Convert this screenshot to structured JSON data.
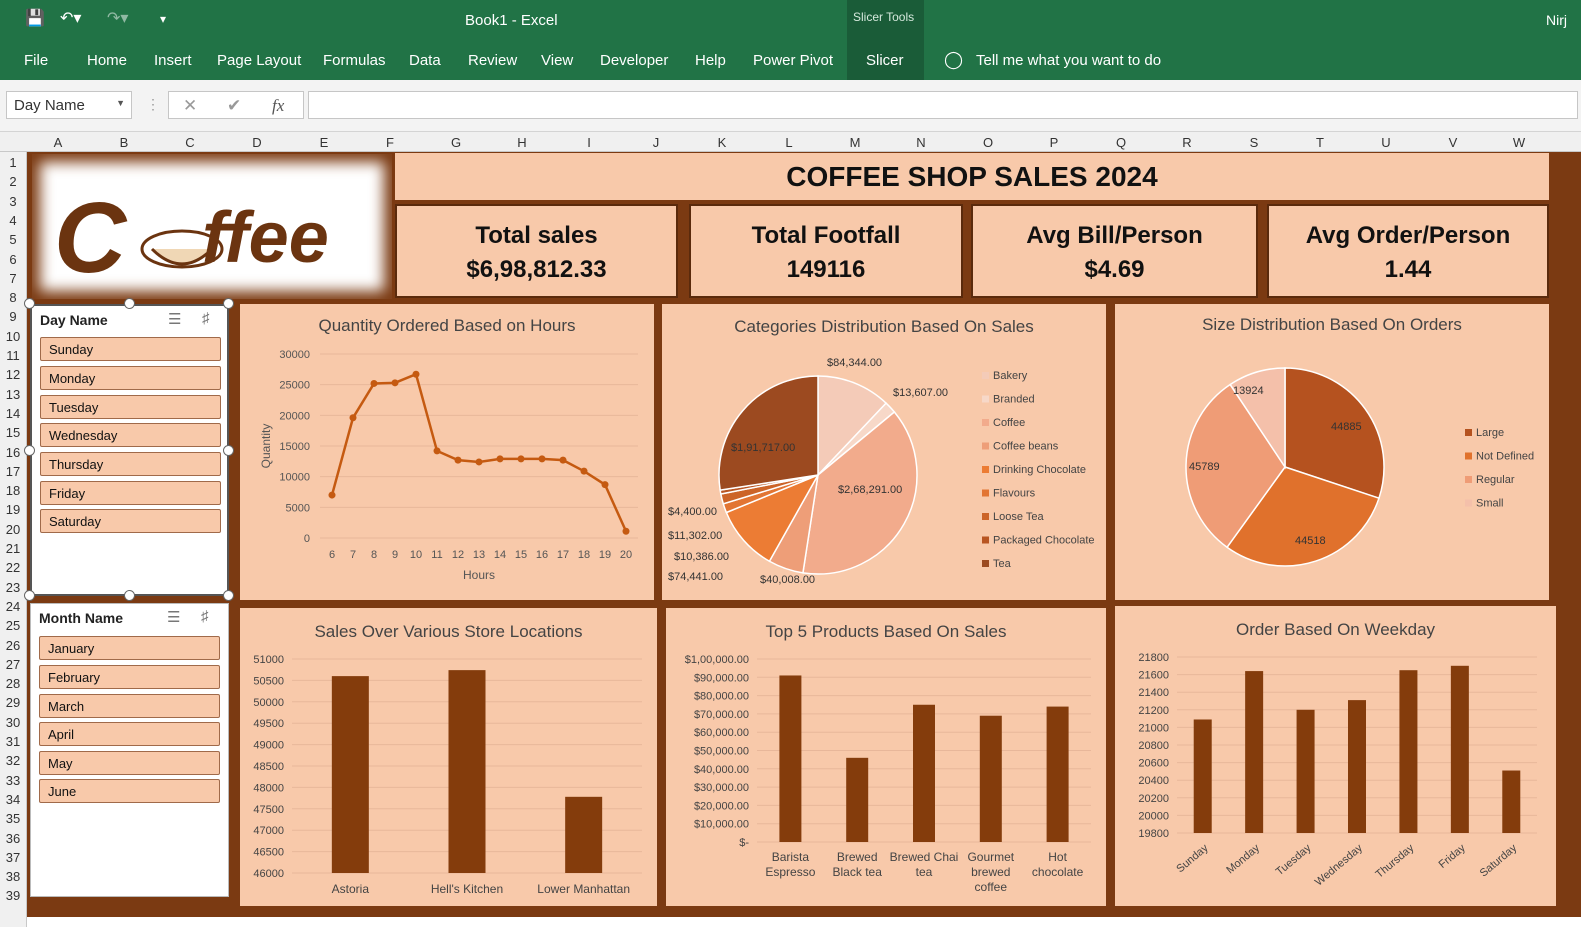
{
  "app": {
    "title": "Book1  -  Excel",
    "user": "Nirj",
    "contextual_tab": "Slicer Tools"
  },
  "menu": [
    "File",
    "Home",
    "Insert",
    "Page Layout",
    "Formulas",
    "Data",
    "Review",
    "View",
    "Developer",
    "Help",
    "Power Pivot",
    "Slicer"
  ],
  "tell_me": "Tell me what you want to do",
  "name_box": "Day Name",
  "columns": [
    "A",
    "B",
    "C",
    "D",
    "E",
    "F",
    "G",
    "H",
    "I",
    "J",
    "K",
    "L",
    "M",
    "N",
    "O",
    "P",
    "Q",
    "R",
    "S",
    "T",
    "U",
    "V",
    "W"
  ],
  "rows": [
    "1",
    "2",
    "3",
    "4",
    "5",
    "6",
    "7",
    "8",
    "9",
    "10",
    "11",
    "12",
    "13",
    "14",
    "15",
    "16",
    "17",
    "18",
    "19",
    "20",
    "21",
    "22",
    "23",
    "24",
    "25",
    "26",
    "27",
    "28",
    "29",
    "30",
    "31",
    "32",
    "33",
    "34",
    "35",
    "36",
    "37",
    "38",
    "39"
  ],
  "dashboard": {
    "title": "COFFEE SHOP SALES 2024",
    "kpis": [
      {
        "label": "Total sales",
        "value": "$6,98,812.33"
      },
      {
        "label": "Total Footfall",
        "value": "149116"
      },
      {
        "label": "Avg Bill/Person",
        "value": "$4.69"
      },
      {
        "label": "Avg Order/Person",
        "value": "1.44"
      }
    ],
    "logo_text": "Coffee"
  },
  "slicers": {
    "day": {
      "header": "Day Name",
      "items": [
        "Sunday",
        "Monday",
        "Tuesday",
        "Wednesday",
        "Thursday",
        "Friday",
        "Saturday"
      ]
    },
    "month": {
      "header": "Month Name",
      "items": [
        "January",
        "February",
        "March",
        "April",
        "May",
        "June"
      ]
    }
  },
  "colors": {
    "ribbon": "#217346",
    "dash_bg": "#7b3a12",
    "panel": "#f8c9aa",
    "bar": "#843c0c",
    "line": "#c55a11"
  },
  "chart_data": [
    {
      "type": "line",
      "title": "Quantity Ordered Based on Hours",
      "xlabel": "Hours",
      "ylabel": "Quantity",
      "x": [
        6,
        7,
        8,
        9,
        10,
        11,
        12,
        13,
        14,
        15,
        16,
        17,
        18,
        19,
        20
      ],
      "values": [
        7000,
        19600,
        25200,
        25300,
        26700,
        14200,
        12700,
        12400,
        12900,
        12900,
        12900,
        12700,
        10900,
        8700,
        1100
      ],
      "ylim": [
        0,
        30000
      ],
      "yticks": [
        0,
        5000,
        10000,
        15000,
        20000,
        25000,
        30000
      ]
    },
    {
      "type": "pie",
      "title": "Categories Distribution Based On Sales",
      "categories": [
        "Bakery",
        "Branded",
        "Coffee",
        "Coffee beans",
        "Drinking Chocolate",
        "Flavours",
        "Loose Tea",
        "Packaged Chocolate",
        "Tea"
      ],
      "values": [
        84344,
        13607,
        268291,
        40008,
        74441,
        10386,
        11302,
        4400,
        191717
      ],
      "labels": [
        "$84,344.00",
        "$13,607.00",
        "$2,68,291.00",
        "$40,008.00",
        "$74,441.00",
        "$10,386.00",
        "$11,302.00",
        "$4,400.00",
        "$1,91,717.00"
      ],
      "colors": [
        "#f4cbb8",
        "#f7d8c8",
        "#f2ab8c",
        "#ee9e78",
        "#ec7c34",
        "#e27533",
        "#cc6428",
        "#b85522",
        "#9c4a20"
      ]
    },
    {
      "type": "pie",
      "title": "Size Distribution Based On Orders",
      "categories": [
        "Large",
        "Not Defined",
        "Regular",
        "Small"
      ],
      "values": [
        44885,
        44518,
        45789,
        13924
      ],
      "labels": [
        "44885",
        "44518",
        "45789",
        "13924"
      ],
      "colors": [
        "#b5521f",
        "#e0712c",
        "#ef9c76",
        "#f4c0aa"
      ]
    },
    {
      "type": "bar",
      "title": "Sales Over Various Store Locations",
      "categories": [
        "Astoria",
        "Hell's Kitchen",
        "Lower Manhattan"
      ],
      "values": [
        50600,
        50740,
        47780
      ],
      "ylim": [
        46000,
        51000
      ],
      "ytick_labels": [
        "46000",
        "46500",
        "47000",
        "47500",
        "48000",
        "48500",
        "49000",
        "49500",
        "50000",
        "50500",
        "51000"
      ]
    },
    {
      "type": "bar",
      "title": "Top 5 Products Based On Sales",
      "categories": [
        "Barista Espresso",
        "Brewed Black tea",
        "Brewed Chai tea",
        "Gourmet brewed coffee",
        "Hot chocolate"
      ],
      "values": [
        91000,
        46000,
        75000,
        69000,
        74000
      ],
      "ylim": [
        0,
        100000
      ],
      "ytick_labels": [
        "$-",
        "$10,000.00",
        "$20,000.00",
        "$30,000.00",
        "$40,000.00",
        "$50,000.00",
        "$60,000.00",
        "$70,000.00",
        "$80,000.00",
        "$90,000.00",
        "$1,00,000.00"
      ]
    },
    {
      "type": "bar",
      "title": "Order Based On Weekday",
      "categories": [
        "Sunday",
        "Monday",
        "Tuesday",
        "Wednesday",
        "Thursday",
        "Friday",
        "Saturday"
      ],
      "values": [
        21090,
        21640,
        21200,
        21310,
        21650,
        21700,
        20510
      ],
      "ylim": [
        19800,
        21800
      ],
      "ytick_labels": [
        "19800",
        "20000",
        "20200",
        "20400",
        "20600",
        "20800",
        "21000",
        "21200",
        "21400",
        "21600",
        "21800"
      ]
    }
  ]
}
